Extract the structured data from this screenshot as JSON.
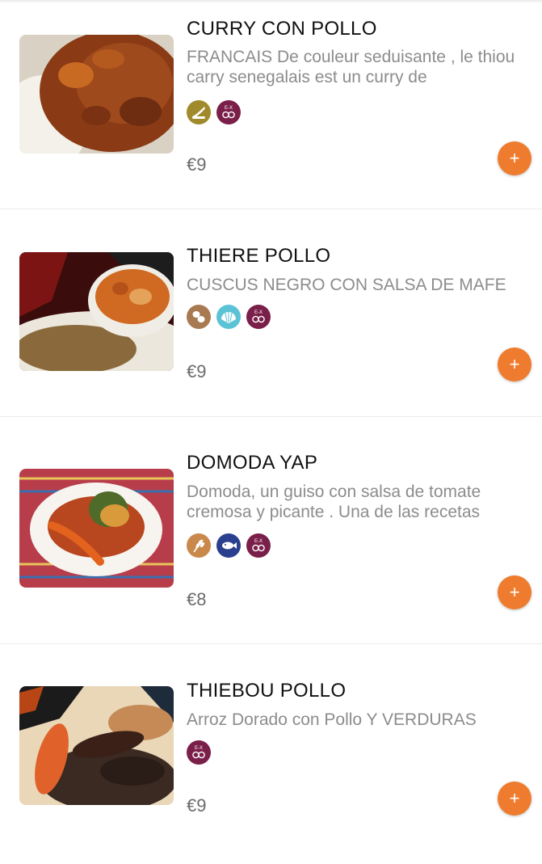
{
  "items": [
    {
      "name": "CURRY CON POLLO",
      "description": "FRANCAIS De couleur seduisante , le thiou carry senegalais est un curry de",
      "price": "€9",
      "allergens": [
        "celery-icon",
        "sulfites-icon"
      ],
      "add_label": "+"
    },
    {
      "name": "THIERE POLLO",
      "description": "CUSCUS NEGRO CON SALSA DE MAFE",
      "price": "€9",
      "allergens": [
        "peanuts-icon",
        "molluscs-icon",
        "sulfites-icon"
      ],
      "add_label": "+"
    },
    {
      "name": "DOMODA YAP",
      "description": "Domoda, un guiso con salsa de tomate cremosa y picante . Una de las recetas",
      "price": "€8",
      "allergens": [
        "gluten-icon",
        "fish-icon",
        "sulfites-icon"
      ],
      "add_label": "+"
    },
    {
      "name": "THIEBOU POLLO",
      "description": "Arroz Dorado con Pollo Y VERDURAS",
      "price": "€9",
      "allergens": [
        "sulfites-icon"
      ],
      "add_label": "+"
    }
  ],
  "allergen_badge_text": "E-X",
  "colors": {
    "accent": "#ef7c2e",
    "celery": "#a08a2c",
    "peanuts": "#a87a52",
    "molluscs": "#5cc3d6",
    "gluten": "#c9894a",
    "fish": "#2b3f8f",
    "sulfites": "#7a1f4a"
  }
}
